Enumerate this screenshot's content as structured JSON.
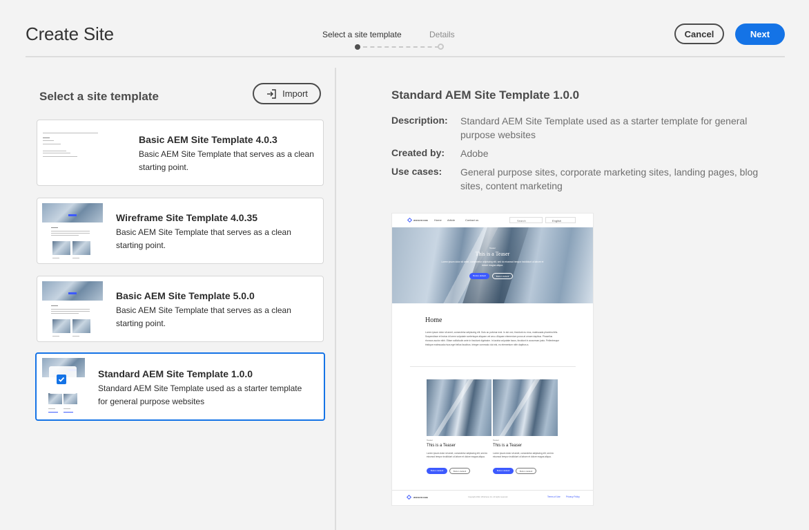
{
  "header": {
    "title": "Create Site",
    "steps": [
      {
        "label": "Select a site template",
        "active": true
      },
      {
        "label": "Details",
        "active": false
      }
    ],
    "cancel_label": "Cancel",
    "next_label": "Next"
  },
  "left": {
    "title": "Select a site template",
    "import_label": "Import",
    "templates": [
      {
        "name": "Basic AEM Site Template 4.0.3",
        "description": "Basic AEM Site Template that serves as a clean starting point.",
        "selected": false
      },
      {
        "name": "Wireframe Site Template 4.0.35",
        "description": "Basic AEM Site Template that serves as a clean starting point.",
        "selected": false
      },
      {
        "name": "Basic AEM Site Template 5.0.0",
        "description": "Basic AEM Site Template that serves as a clean starting point.",
        "selected": false
      },
      {
        "name": "Standard AEM Site Template 1.0.0",
        "description": "Standard AEM Site Template used as a starter template for general purpose websites",
        "selected": true
      }
    ]
  },
  "details": {
    "title": "Standard AEM Site Template 1.0.0",
    "description_label": "Description:",
    "description": "Standard AEM Site Template used as a starter template for general purpose websites",
    "created_by_label": "Created by:",
    "created_by": "Adobe",
    "use_cases_label": "Use cases:",
    "use_cases": "General purpose sites, corporate marketing sites, landing pages, blog sites, content marketing"
  },
  "preview": {
    "brand": "WIREFRAME",
    "nav": [
      "Home",
      "Article",
      "Contact us"
    ],
    "search_placeholder": "Search",
    "language": "English",
    "hero_kicker": "Teaser",
    "hero_title": "This is a Teaser",
    "hero_text": "Lorem ipsum dolor sit amet, consectetur adipiscing elit, sed do eiusmod tempor incididunt ut labore et dolore magna aliqua.",
    "button_default": "Button default",
    "page_heading": "Home",
    "body_text": "Lorem ipsum dolor sit amet, consectetur adipiscing elit. Duis ac pulvinar erat. In dui orci, tincidunt eu eros, malesuada pharetra felis. Suspendisse et lectus id lorem vulputate scelerisque aliquam vel arcu. Aliquam elementum purus at ornare dapibus. Phasellus rhoncus auctor nibh. Etiam sollicitudin ante in tincidunt dignissim. In lacinia vulputate lacus, tincidunt in accumsan justo. Pellentesque tristique malesuada risus eget tellus faucibus. Integer commodo dui nisl, eu elementum nibh dapibus a.",
    "card_kicker": "Teaser",
    "card_title": "This is a Teaser",
    "card_text": "Lorem ipsum dolor sit amet, consectetur adipiscing elit, sed do eiusmod tempor incididunt ut labore et dolore magna aliqua.",
    "footer_copy": "Copyright 2022, Wireframe Inc. All rights reserved.",
    "footer_links": [
      "Terms of Use",
      "Privacy Policy"
    ]
  },
  "colors": {
    "accent": "#1473e6",
    "preview_accent": "#3d5afe"
  }
}
